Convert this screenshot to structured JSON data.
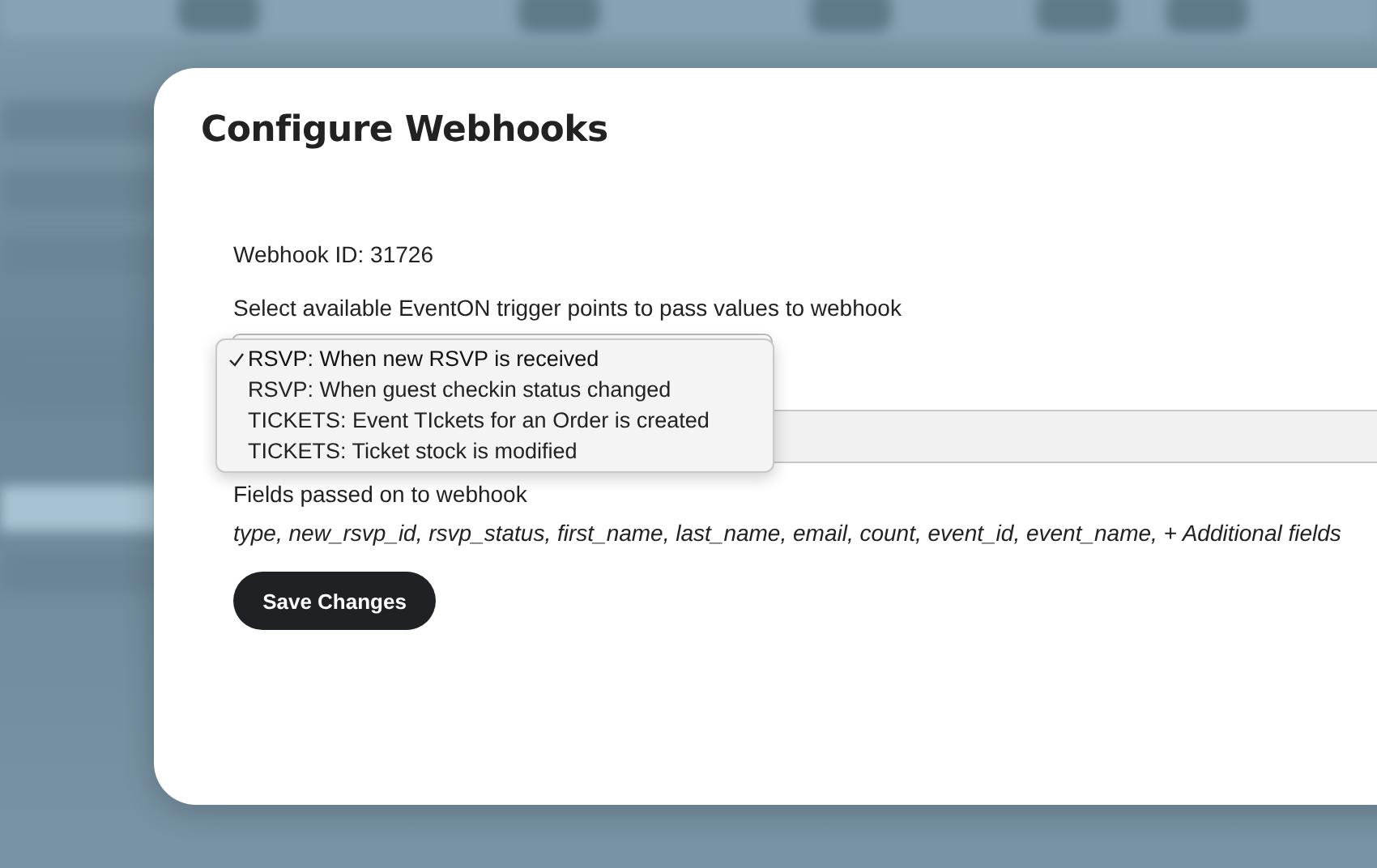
{
  "dialog": {
    "title": "Configure Webhooks",
    "webhook_id": "Webhook ID: 31726",
    "trigger_label": "Select available EventON trigger points to pass values to webhook",
    "trigger_options": [
      {
        "label": "RSVP: When new RSVP is received",
        "selected": true
      },
      {
        "label": "RSVP: When guest checkin status changed",
        "selected": false
      },
      {
        "label": "TICKETS: Event TIckets for an Order is created",
        "selected": false
      },
      {
        "label": "TICKETS: Ticket stock is modified",
        "selected": false
      }
    ],
    "fields_label": "Fields passed on to webhook",
    "fields_list": "type, new_rsvp_id, rsvp_status, first_name, last_name, email, count, event_id, event_name, + Additional fields",
    "save_button": "Save Changes"
  }
}
